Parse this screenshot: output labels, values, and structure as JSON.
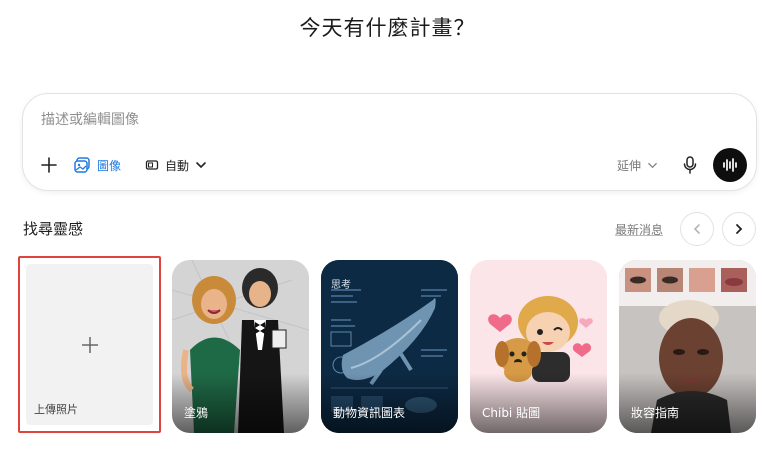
{
  "headline": "今天有什麼計畫？",
  "composer": {
    "placeholder": "描述或編輯圖像",
    "image_label": "圖像",
    "ratio_label": "自動",
    "extend_label": "延伸"
  },
  "inspiration": {
    "title": "找尋靈感",
    "news_link": "最新消息",
    "cards": [
      {
        "label": "上傳照片"
      },
      {
        "label": "塗鴉"
      },
      {
        "label": "動物資訊圖表"
      },
      {
        "label": "Chibi 貼圖"
      },
      {
        "label": "妝容指南"
      }
    ],
    "infographic_heading": "思考"
  },
  "colors": {
    "accent": "#1f7ae0",
    "selection_border": "#e0433b",
    "voice_button": "#0e0e0e"
  }
}
